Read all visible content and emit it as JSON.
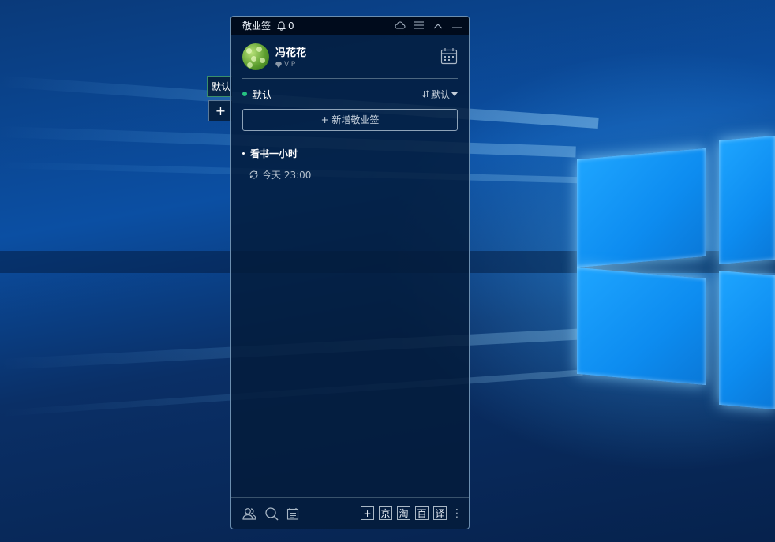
{
  "app": {
    "title": "敬业签",
    "notification_count": "0"
  },
  "side_tabs": {
    "default_label": "默认",
    "add_label": "+"
  },
  "profile": {
    "name": "冯花花",
    "badge": "VIP"
  },
  "group": {
    "name": "默认",
    "sort_label": "默认"
  },
  "add_button": {
    "label": "+ 新增敬业签"
  },
  "tasks": [
    {
      "title": "看书一小时",
      "time": "今天 23:00"
    }
  ],
  "footer": {
    "buttons": [
      "+",
      "京",
      "淘",
      "百",
      "译"
    ]
  },
  "colors": {
    "accent_green": "#26c281",
    "panel_bg": "#031c3a"
  }
}
